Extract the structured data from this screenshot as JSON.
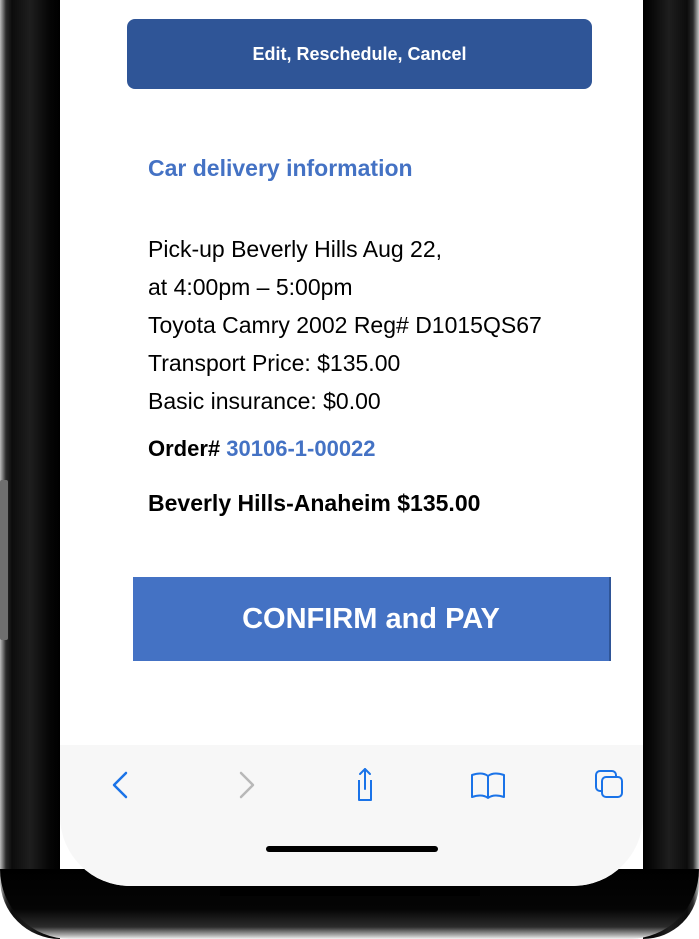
{
  "header": {
    "edit_label": "Edit, Reschedule, Cancel"
  },
  "delivery": {
    "title": "Car delivery information",
    "lines": [
      "Pick-up Beverly Hills  Aug 22,",
      "at 4:00pm – 5:00pm",
      "Toyota Camry 2002  Reg# D1015QS67",
      "Transport Price:  $135.00",
      "Basic insurance:  $0.00"
    ],
    "order_label": "Order#",
    "order_number": "30106-1-00022",
    "route_summary": "Beverly Hills-Anaheim $135.00"
  },
  "actions": {
    "confirm_label": "CONFIRM and PAY"
  },
  "toolbar": {
    "icons": [
      "back-icon",
      "forward-icon",
      "share-icon",
      "bookmarks-icon",
      "tabs-icon"
    ],
    "accent_color": "#1a73e8",
    "disabled_color": "#b8b8b8"
  },
  "colors": {
    "primary_dark": "#2f5597",
    "primary": "#4472c4"
  }
}
